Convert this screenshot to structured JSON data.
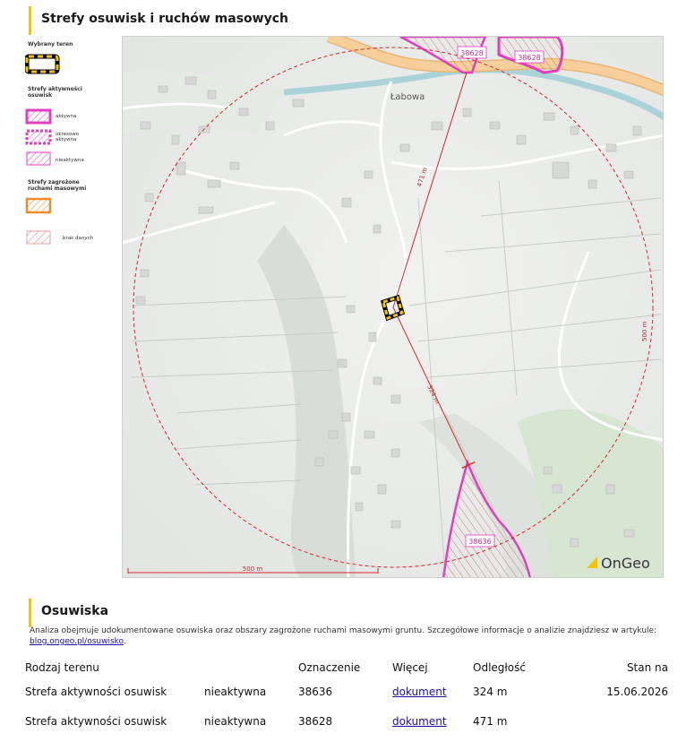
{
  "section1_title": "Strefy osuwisk i ruchów masowych",
  "legend": {
    "selected_title": "Wybrany teren",
    "zones_title": "Strefy aktywności osuwisk",
    "items": [
      {
        "label": "aktywna"
      },
      {
        "label": "okresowo aktywna"
      },
      {
        "label": "nieaktywna"
      }
    ],
    "threat_title": "Strefy zagrożone ruchami masowymi",
    "no_data_label": "brak danych"
  },
  "map": {
    "place_label": "Łabowa",
    "zone_labels": [
      "38628",
      "38628",
      "38636"
    ],
    "distance_north": "471 m",
    "distance_south": "324 m",
    "radius_label": "500 m",
    "scale_label": "500 m",
    "brand": "OnGeo",
    "colors": {
      "zone": "#e040c0",
      "radius": "#d9252b",
      "selected": "#f5c400",
      "road_main": "#f3c48a",
      "river": "#a9d3d8"
    }
  },
  "section2_title": "Osuwiska",
  "description": {
    "text": "Analiza obejmuje udokumentowane osuwiska oraz obszary zagrożone ruchami masowymi gruntu. Szczegółowe informacje o analizie znajdziesz w artykule: ",
    "link": "blog.ongeo.pl/osuwisko",
    "tail": "."
  },
  "table": {
    "headers": [
      "Rodzaj terenu",
      "",
      "Oznaczenie",
      "Więcej",
      "Odległość",
      "Stan na"
    ],
    "rows": [
      {
        "type": "Strefa aktywności osuwisk",
        "status": "nieaktywna",
        "id": "38636",
        "link": "dokument",
        "distance": "324 m",
        "date": "15.06.2026"
      },
      {
        "type": "Strefa aktywności osuwisk",
        "status": "nieaktywna",
        "id": "38628",
        "link": "dokument",
        "distance": "471 m",
        "date": ""
      }
    ]
  }
}
